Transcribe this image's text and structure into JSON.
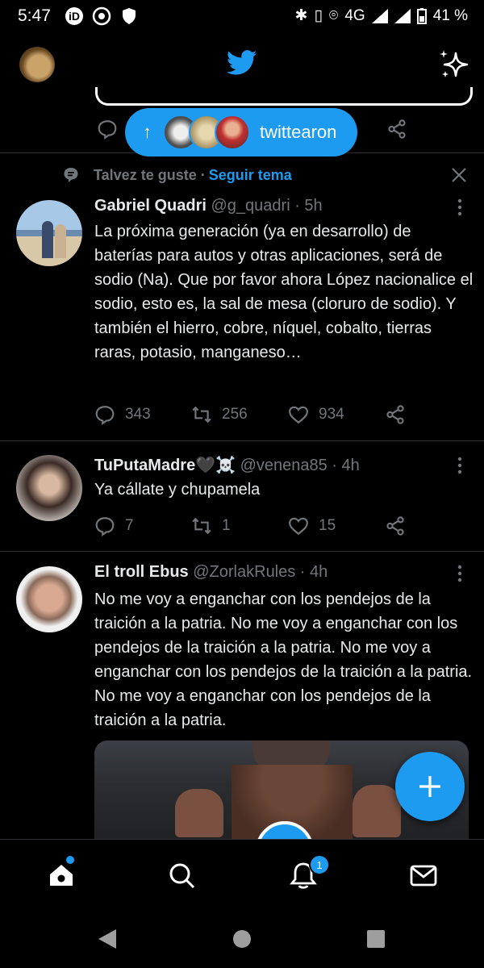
{
  "status_bar": {
    "time": "5:47",
    "network": "4G",
    "battery": "41 %"
  },
  "top_bar": {
    "logo": "twitter-bird-icon",
    "action_icon": "sparkle-icon"
  },
  "new_tweets_pill": {
    "label": "twittearon",
    "arrow": "↑"
  },
  "suggestion": {
    "text": "Talvez te guste ·",
    "link": "Seguir tema"
  },
  "tweets": [
    {
      "name": "Gabriel Quadri",
      "handle": "@g_quadri · 5h",
      "text": "La próxima generación (ya en desarrollo) de baterías para autos y otras aplicaciones, será de sodio (Na). Que por favor ahora López nacionalice el sodio, esto es, la sal de mesa (cloruro de sodio). Y también el hierro, cobre, níquel, cobalto, tierras raras, potasio, manganeso…",
      "replies": "343",
      "retweets": "256",
      "likes": "934"
    },
    {
      "name": "TuPutaMadre🖤☠️",
      "handle": "@venena85 · 4h",
      "text": "Ya cállate y chupamela",
      "replies": "7",
      "retweets": "1",
      "likes": "15"
    },
    {
      "name": "El troll Ebus",
      "handle": "@ZorlakRules · 4h",
      "text": "No me voy a enganchar con los pendejos de la traición a la patria. No me voy a enganchar con los pendejos de la traición a la patria. No me voy a enganchar con los pendejos de la traición a la patria. No me voy a enganchar con los pendejos de la traición a la patria."
    }
  ],
  "bottom_nav": {
    "notifications_badge": "1"
  },
  "colors": {
    "accent": "#1d9bf0",
    "background": "#000000",
    "muted": "#71767b"
  }
}
